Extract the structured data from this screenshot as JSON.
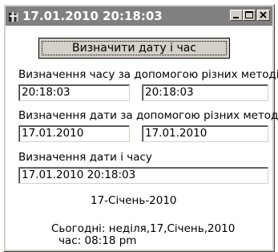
{
  "window": {
    "title": "17.01.2010 20:18:03",
    "icon": "app-icon",
    "controls": {
      "minimize": "minimize-icon",
      "maximize": "maximize-icon",
      "close": "close-icon"
    }
  },
  "main_button": {
    "label": "Визначити дату і час"
  },
  "time_section": {
    "label": "Визначення часу за допомогою різних методів",
    "field1": "20:18:03",
    "field2": "20:18:03"
  },
  "date_section": {
    "label": "Визначення дати за допомогою різних методів",
    "field1": "17.01.2010",
    "field2": "17.01.2010"
  },
  "datetime_section": {
    "label": "Визначення дати і часу",
    "field": "17.01.2010 20:18:03"
  },
  "date_long": "17-Січень-2010",
  "today_line": "Сьогодні: неділя,17,Січень,2010",
  "time_line": "час:  08:18 pm"
}
